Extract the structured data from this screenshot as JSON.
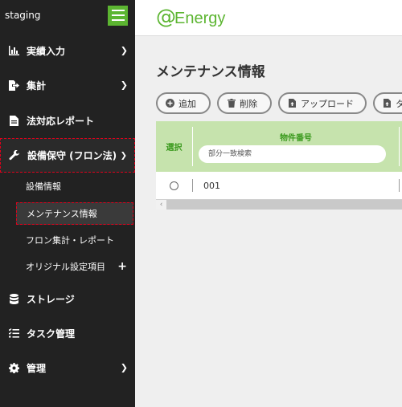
{
  "environment": "staging",
  "sidebar": {
    "items": [
      {
        "label": "実績入力",
        "icon": "bar-chart-icon"
      },
      {
        "label": "集計",
        "icon": "export-icon"
      },
      {
        "label": "法対応レポート",
        "icon": "document-icon"
      },
      {
        "label": "設備保守 (フロン法)",
        "icon": "wrench-icon"
      },
      {
        "label": "ストレージ",
        "icon": "database-icon"
      },
      {
        "label": "タスク管理",
        "icon": "task-list-icon"
      },
      {
        "label": "管理",
        "icon": "gear-icon"
      }
    ],
    "subitems": [
      {
        "label": "設備情報"
      },
      {
        "label": "メンテナンス情報"
      },
      {
        "label": "フロン集計・レポート"
      },
      {
        "label": "オリジナル設定項目"
      }
    ]
  },
  "header": {
    "logo_at": "@",
    "logo_text": "Energy"
  },
  "main": {
    "title": "メンテナンス情報",
    "buttons": [
      {
        "label": "追加",
        "icon": "plus-circle-icon"
      },
      {
        "label": "削除",
        "icon": "trash-icon"
      },
      {
        "label": "アップロード",
        "icon": "file-upload-icon"
      },
      {
        "label": "タ",
        "icon": "file-icon"
      }
    ],
    "table": {
      "select_header": "選択",
      "name_header": "物件番号",
      "filter_placeholder": "部分一致検索",
      "rows": [
        {
          "id": "001"
        }
      ]
    }
  },
  "colors": {
    "accent": "#5cb531",
    "sidebar": "#222222",
    "header_row": "#c6e3ad",
    "active_outline": "#e0001b"
  }
}
